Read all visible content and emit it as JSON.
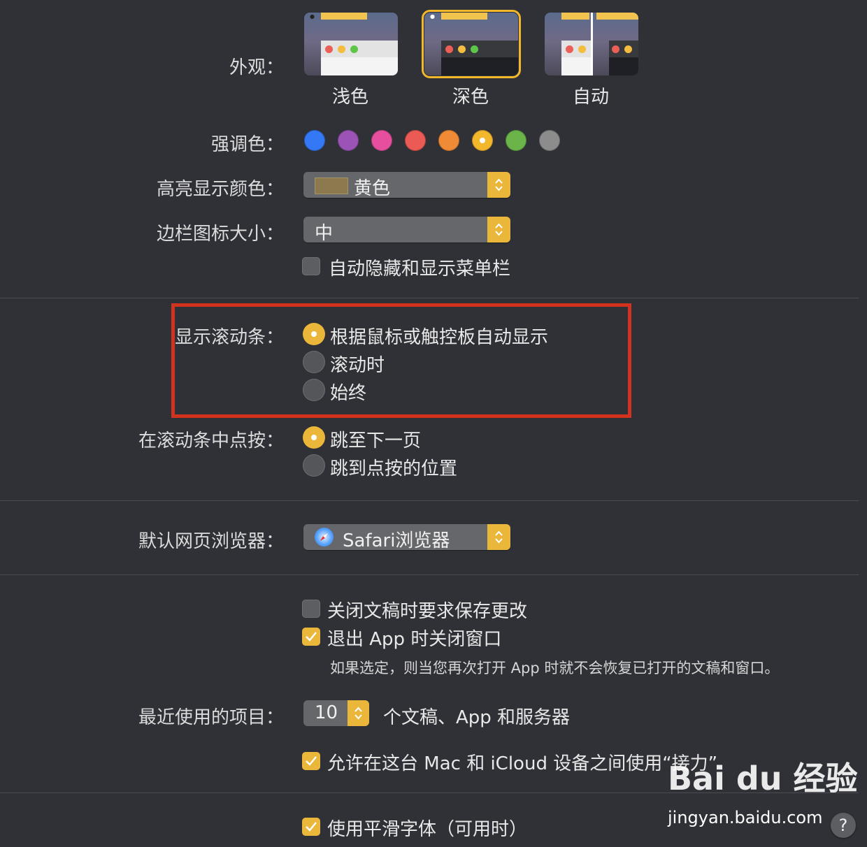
{
  "appearance": {
    "label": "外观：",
    "options": [
      "浅色",
      "深色",
      "自动"
    ],
    "selected": "深色"
  },
  "accent": {
    "label": "强调色：",
    "colors": [
      "#3478f6",
      "#9b54b5",
      "#e64f9e",
      "#eb5a55",
      "#ef8b36",
      "#f3b72c",
      "#6ab44a",
      "#8c8c8c"
    ],
    "selected_index": 5
  },
  "highlight": {
    "label": "高亮显示颜色：",
    "value": "黄色",
    "chip_color": "#8c7a4e"
  },
  "sidebar_icon": {
    "label": "边栏图标大小：",
    "value": "中"
  },
  "auto_hide_menubar": {
    "label": "自动隐藏和显示菜单栏",
    "checked": false
  },
  "scrollbars": {
    "label": "显示滚动条：",
    "options": [
      "根据鼠标或触控板自动显示",
      "滚动时",
      "始终"
    ],
    "selected_index": 0
  },
  "scroll_click": {
    "label": "在滚动条中点按：",
    "options": [
      "跳至下一页",
      "跳到点按的位置"
    ],
    "selected_index": 0
  },
  "browser": {
    "label": "默认网页浏览器：",
    "value": "Safari浏览器"
  },
  "ask_keep_changes": {
    "label": "关闭文稿时要求保存更改",
    "checked": false
  },
  "close_windows": {
    "label": "退出 App 时关闭窗口",
    "checked": true
  },
  "close_windows_note": "如果选定，则当您再次打开 App 时就不会恢复已打开的文稿和窗口。",
  "recent_items": {
    "label": "最近使用的项目：",
    "value": "10",
    "suffix": "个文稿、App 和服务器"
  },
  "handoff": {
    "label": "允许在这台 Mac 和 iCloud 设备之间使用“接力”",
    "checked": true
  },
  "font_smoothing": {
    "label": "使用平滑字体（可用时）",
    "checked": true
  },
  "watermark": {
    "logo": "Bai du 经验",
    "url": "jingyan.baidu.com"
  },
  "help_label": "?"
}
